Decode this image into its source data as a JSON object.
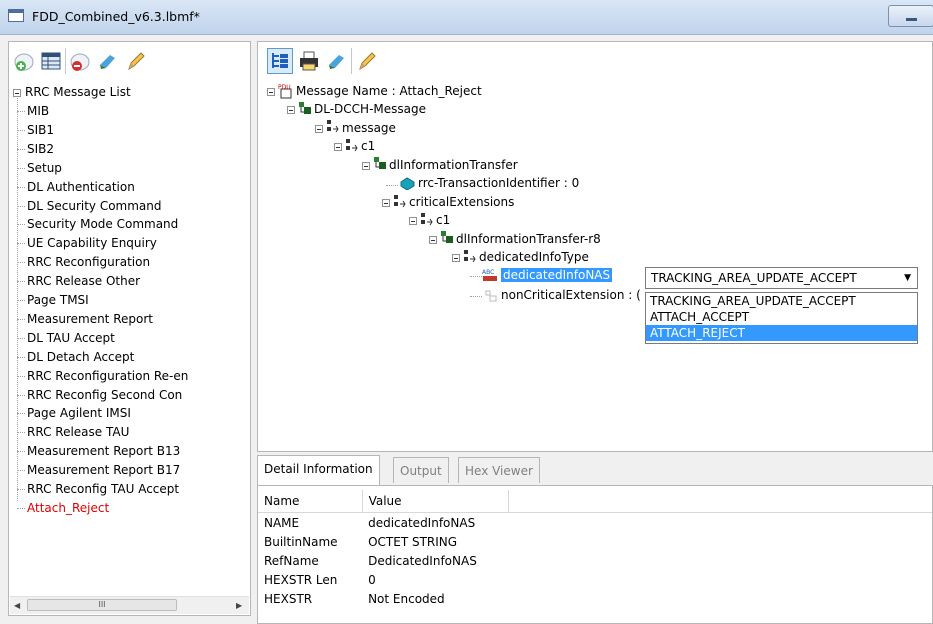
{
  "window": {
    "title": "FDD_Combined_v6.3.lbmf*"
  },
  "left_tree": {
    "root": "RRC Message List",
    "items": [
      "MIB",
      "SIB1",
      "SIB2",
      "Setup",
      "DL Authentication",
      "DL Security Command",
      "Security Mode Command",
      "UE Capability Enquiry",
      "RRC Reconfiguration",
      "RRC Release Other",
      "Page TMSI",
      "Measurement Report",
      "DL TAU Accept",
      "DL Detach Accept",
      "RRC Reconfiguration Re-en",
      "RRC Reconfig Second Con",
      "Page Agilent IMSI",
      "RRC Release TAU",
      "Measurement Report B13",
      "Measurement Report B17",
      "RRC Reconfig TAU Accept",
      "Attach_Reject"
    ],
    "scroll_glyph": "III"
  },
  "msg_tree": {
    "root": "Message Name : Attach_Reject",
    "n1": "DL-DCCH-Message",
    "n2": "message",
    "n3": "c1",
    "n4": "dlInformationTransfer",
    "n5": "rrc-TransactionIdentifier : 0",
    "n6": "criticalExtensions",
    "n7": "c1",
    "n8": "dlInformationTransfer-r8",
    "n9": "dedicatedInfoType",
    "n10": "dedicatedInfoNAS",
    "n11": "nonCriticalExtension : (",
    "pdu_badge": "PDU",
    "abc_badge": "ABC"
  },
  "dropdown": {
    "value": "TRACKING_AREA_UPDATE_ACCEPT",
    "options": [
      "TRACKING_AREA_UPDATE_ACCEPT",
      "ATTACH_ACCEPT",
      "ATTACH_REJECT"
    ],
    "selected": "ATTACH_REJECT"
  },
  "tabs": [
    "Detail Information",
    "Output",
    "Hex Viewer"
  ],
  "detail": {
    "headers": [
      "Name",
      "Value"
    ],
    "rows": [
      [
        "NAME",
        "dedicatedInfoNAS"
      ],
      [
        "BuiltinName",
        "OCTET STRING"
      ],
      [
        "RefName",
        "DedicatedInfoNAS"
      ],
      [
        "HEXSTR Len",
        "0"
      ],
      [
        "HEXSTR",
        "Not Encoded"
      ]
    ]
  },
  "colors": {
    "selection": "#3399ff",
    "active_item": "#e00000"
  }
}
